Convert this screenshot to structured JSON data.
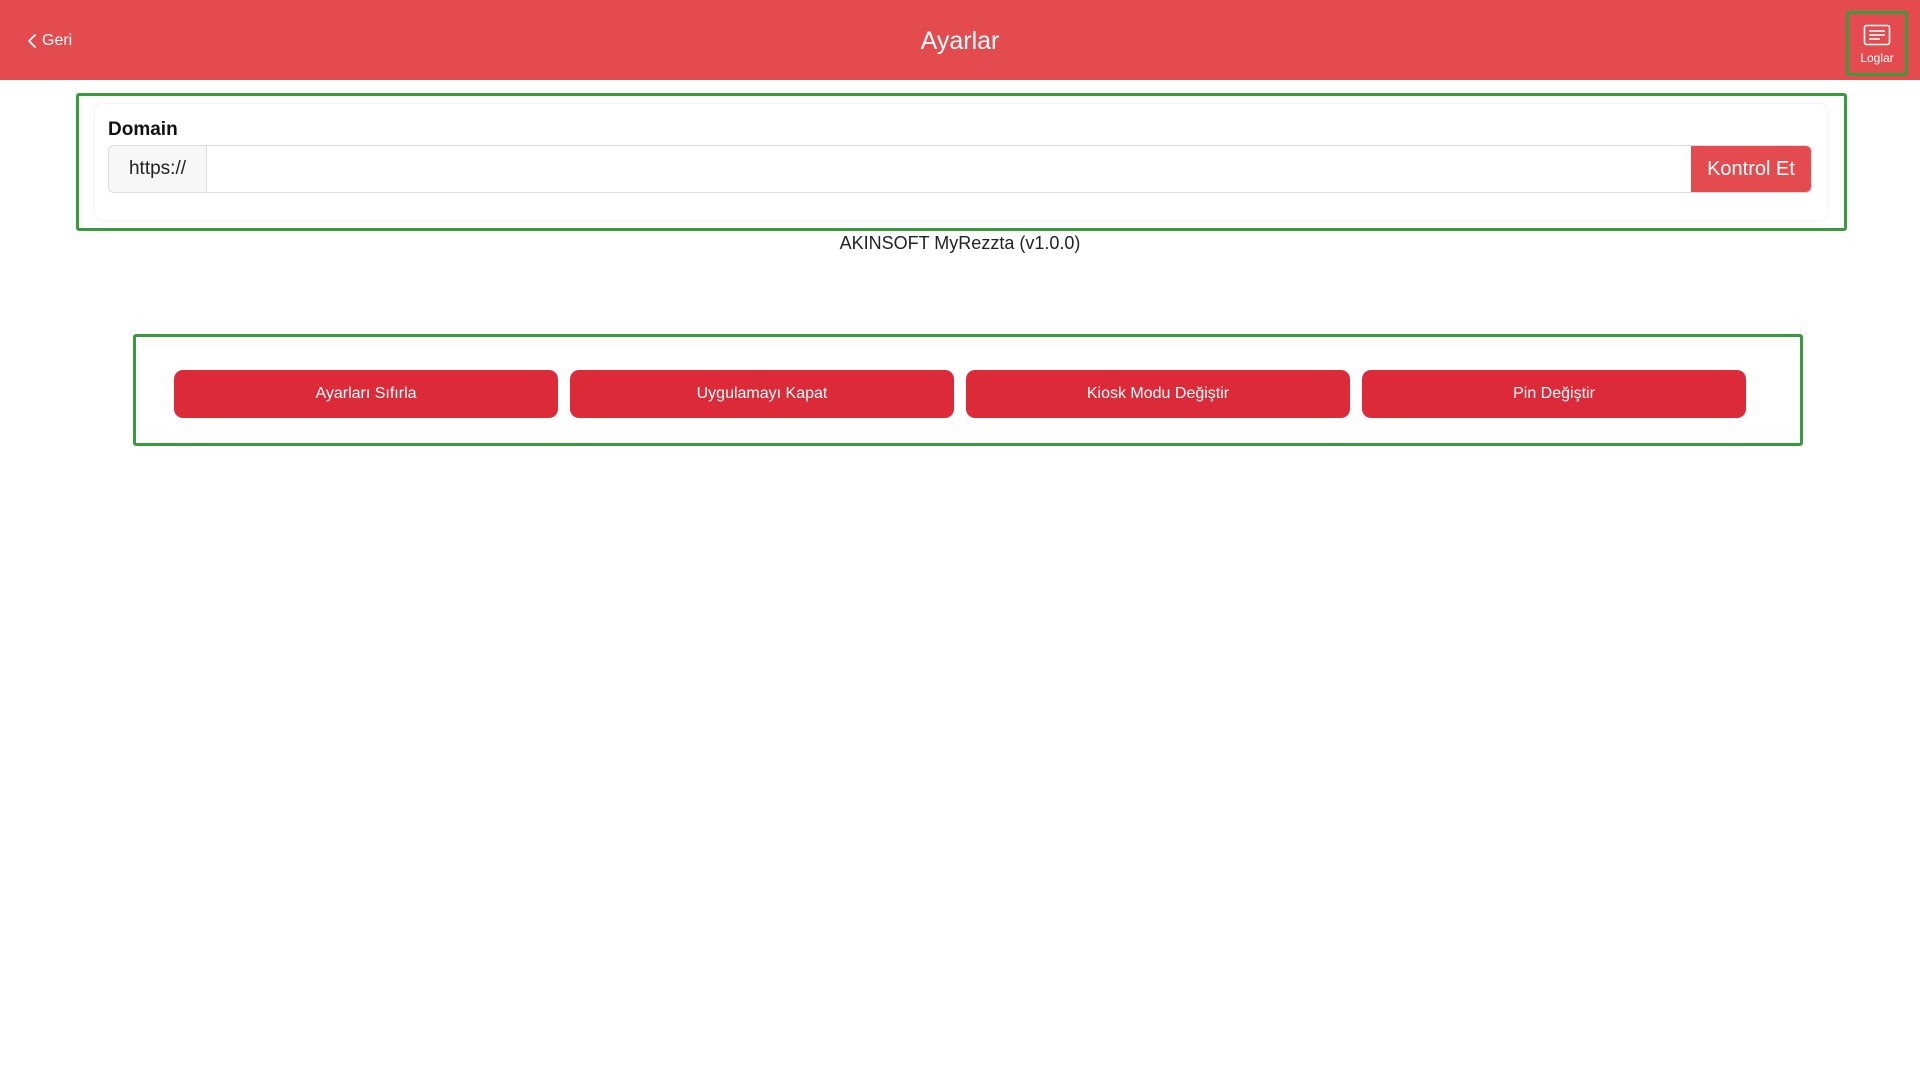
{
  "header": {
    "back_label": "Geri",
    "title": "Ayarlar",
    "logs_label": "Loglar",
    "background_color": "#e44b4f"
  },
  "domain": {
    "label": "Domain",
    "prefix": "https://",
    "value": "",
    "placeholder": "",
    "check_label": "Kontrol Et"
  },
  "app_info": {
    "version_text": "AKINSOFT MyRezzta (v1.0.0)"
  },
  "actions": {
    "reset_label": "Ayarları Sıfırla",
    "close_label": "Uygulamayı Kapat",
    "kiosk_label": "Kiosk Modu Değiştir",
    "pin_label": "Pin Değiştir",
    "button_color": "#dc2a38"
  },
  "highlight_color": "#3a9b3c"
}
